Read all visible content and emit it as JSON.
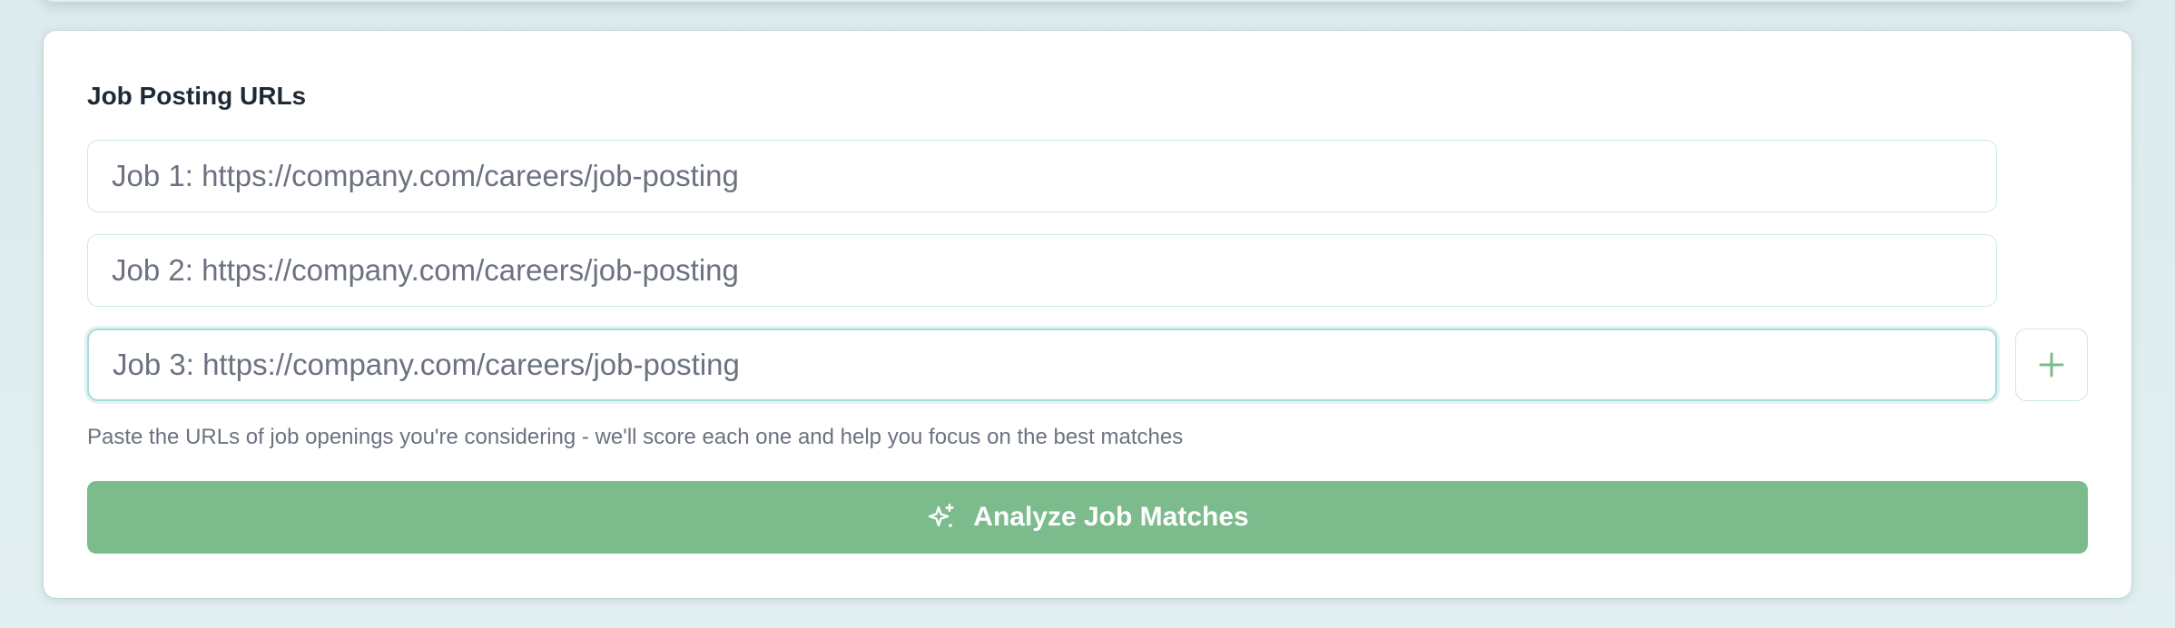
{
  "section": {
    "title": "Job Posting URLs"
  },
  "urls": [
    {
      "placeholder": "Job 1: https://company.com/careers/job-posting",
      "value": ""
    },
    {
      "placeholder": "Job 2: https://company.com/careers/job-posting",
      "value": ""
    },
    {
      "placeholder": "Job 3: https://company.com/careers/job-posting",
      "value": ""
    }
  ],
  "add_button": {
    "icon": "plus-icon"
  },
  "helper_text": "Paste the URLs of job openings you're considering - we'll score each one and help you focus on the best matches",
  "analyze_button": {
    "label": "Analyze Job Matches",
    "icon": "sparkles-icon"
  },
  "colors": {
    "accent": "#7bbb8c",
    "input_border": "#cfe6e8",
    "focus_border": "#a8dcd8",
    "background": "#dcebed"
  }
}
